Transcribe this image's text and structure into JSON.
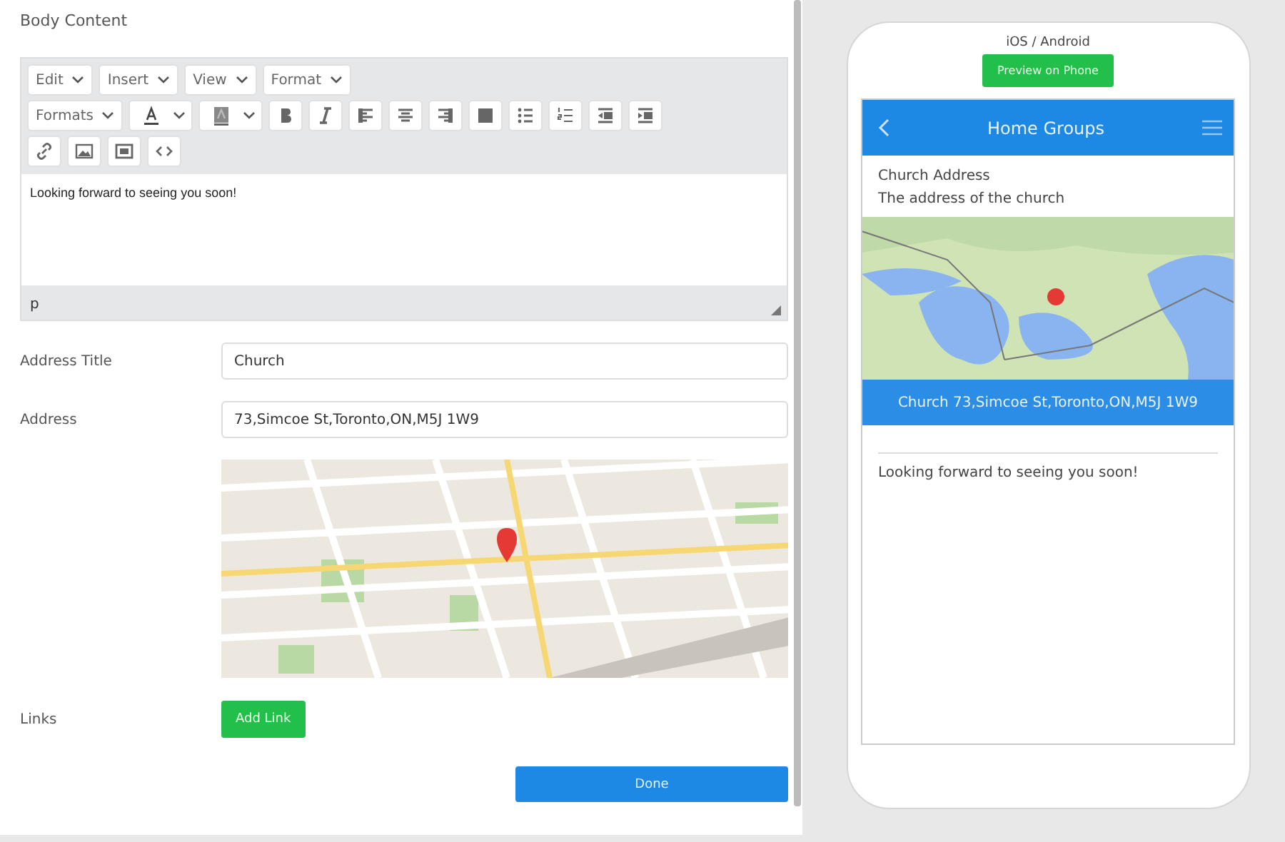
{
  "editor": {
    "label": "Body Content",
    "menus": [
      "Edit",
      "Insert",
      "View",
      "Format"
    ],
    "formats_dropdown": "Formats",
    "content": "Looking forward to seeing you soon!",
    "status_path": "p"
  },
  "fields": [
    {
      "label": "Address Title",
      "value": "Church"
    },
    {
      "label": "Address",
      "value": "73,Simcoe St,Toronto,ON,M5J 1W9"
    }
  ],
  "links": {
    "label": "Links",
    "button": "Add Link"
  },
  "done_button": "Done",
  "preview": {
    "platform": "iOS / Android",
    "button": "Preview on Phone",
    "header_title": "Home Groups",
    "section_title": "Church Address",
    "section_subtitle": "The address of the church",
    "map_caption": "Church 73,Simcoe St,Toronto,ON,M5J 1W9",
    "body": "Looking forward to seeing you soon!"
  }
}
